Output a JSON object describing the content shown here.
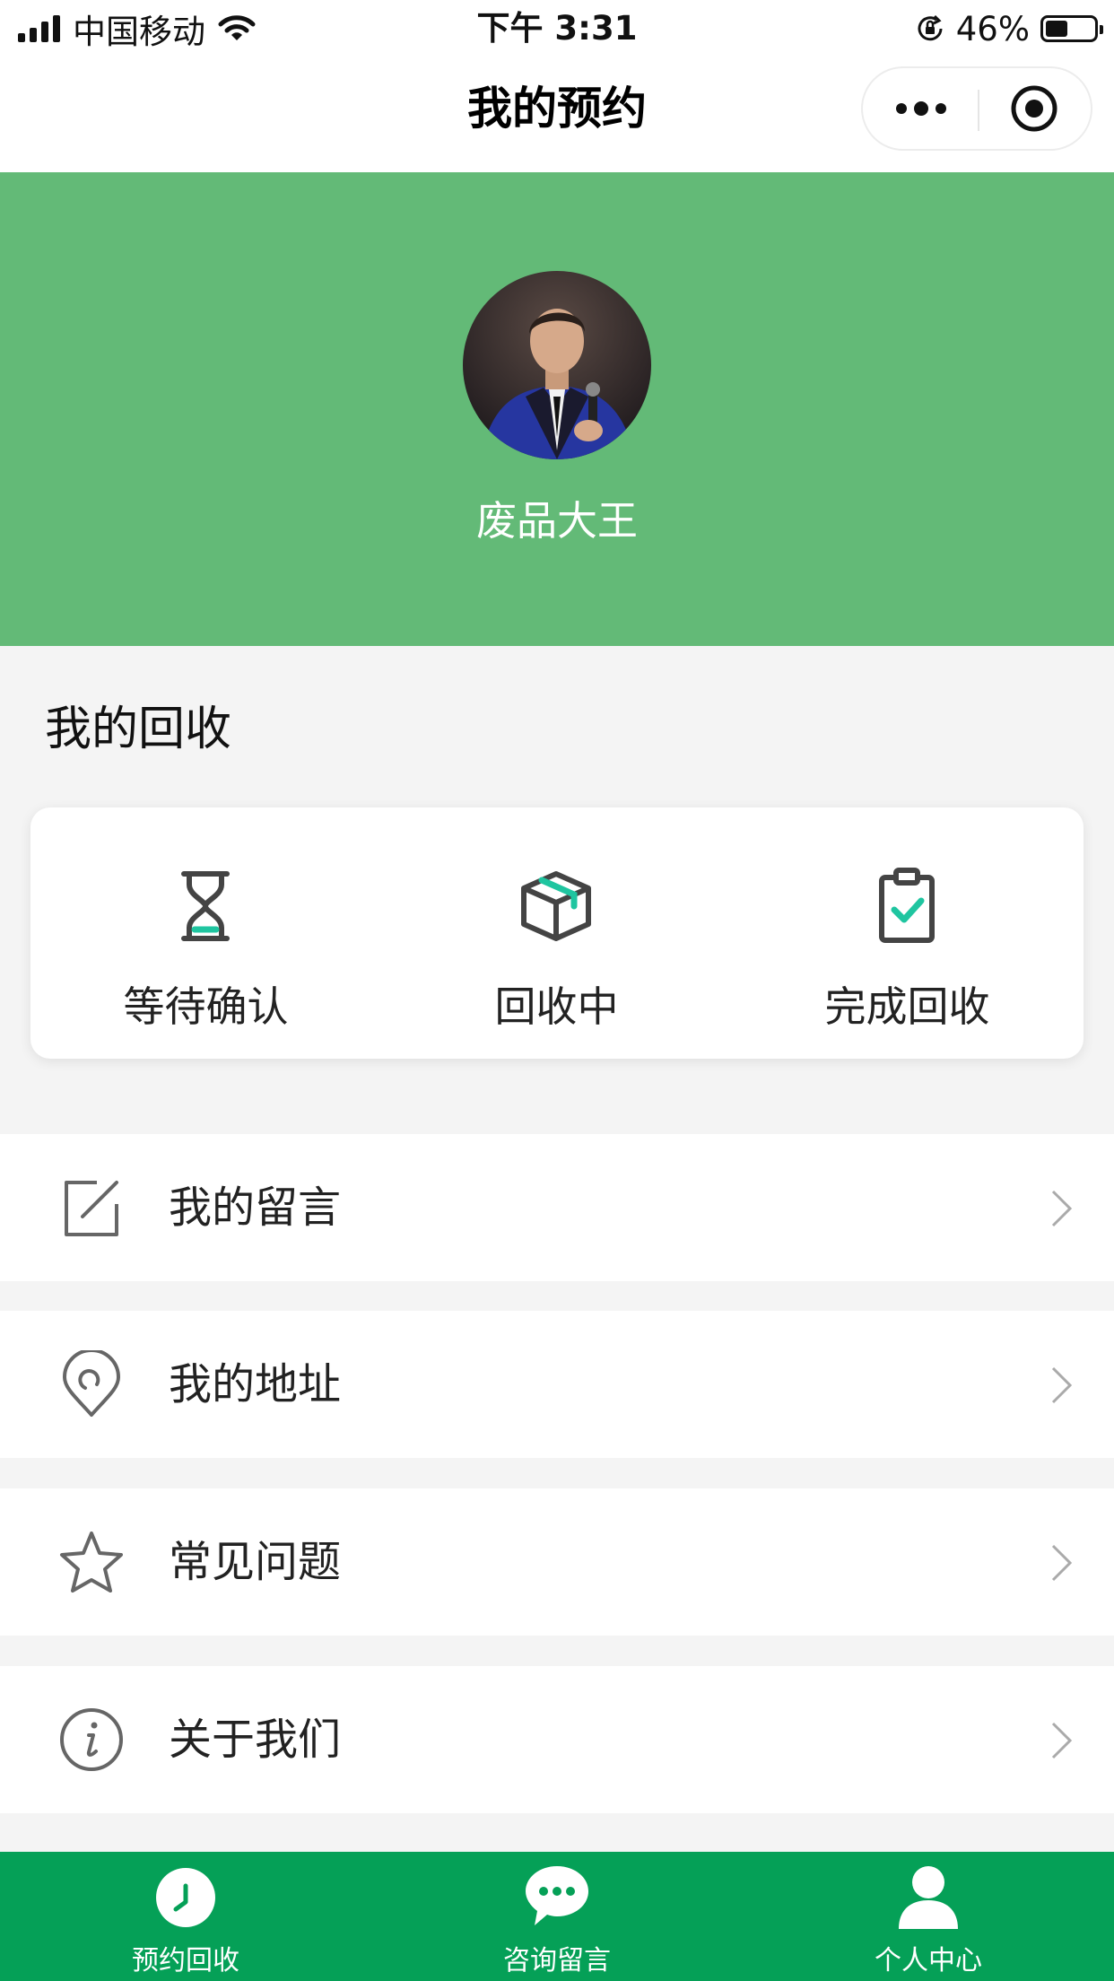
{
  "status_bar": {
    "carrier": "中国移动",
    "time": "下午 3:31",
    "battery_percent_text": "46%",
    "battery_level": 0.46,
    "icons": [
      "signal-icon",
      "wifi-icon",
      "orientation-lock-icon",
      "battery-icon"
    ]
  },
  "navbar": {
    "title": "我的预约",
    "more_icon": "more-dots-icon",
    "close_icon": "target-circle-icon"
  },
  "profile": {
    "username": "废品大王",
    "avatar": "avatar"
  },
  "recycle": {
    "section_title": "我的回收",
    "items": [
      {
        "label": "等待确认",
        "icon": "hourglass-icon"
      },
      {
        "label": "回收中",
        "icon": "box-icon"
      },
      {
        "label": "完成回收",
        "icon": "clipboard-check-icon"
      }
    ]
  },
  "menu": [
    {
      "label": "我的留言",
      "icon": "edit-icon"
    },
    {
      "label": "我的地址",
      "icon": "location-pin-icon"
    },
    {
      "label": "常见问题",
      "icon": "star-icon"
    },
    {
      "label": "关于我们",
      "icon": "info-icon"
    }
  ],
  "tabbar": [
    {
      "label": "预约回收",
      "icon": "clock-icon"
    },
    {
      "label": "咨询留言",
      "icon": "chat-bubble-icon"
    },
    {
      "label": "个人中心",
      "icon": "user-icon"
    }
  ],
  "colors": {
    "hero_green": "#63ba77",
    "tabbar_green": "#05a057",
    "accent_teal": "#1fc5a0",
    "background": "#f4f4f4"
  }
}
